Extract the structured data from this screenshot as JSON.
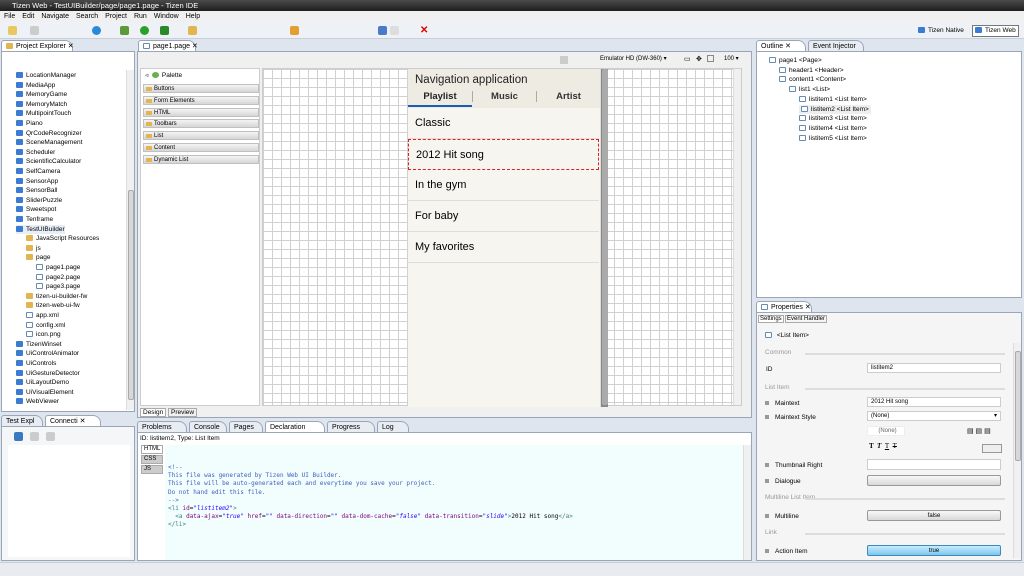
{
  "window": {
    "title": "Tizen Web - TestUIBuilder/page/page1.page - Tizen IDE"
  },
  "menu": [
    "File",
    "Edit",
    "Navigate",
    "Search",
    "Project",
    "Run",
    "Window",
    "Help"
  ],
  "perspectives": {
    "native": "Tizen Native",
    "web": "Tizen Web"
  },
  "project_explorer": {
    "title": "Project Explorer",
    "items": [
      {
        "label": "LocationManager",
        "type": "project",
        "level": 0
      },
      {
        "label": "MediaApp",
        "type": "project",
        "level": 0
      },
      {
        "label": "MemoryGame",
        "type": "project",
        "level": 0
      },
      {
        "label": "MemoryMatch",
        "type": "project",
        "level": 0
      },
      {
        "label": "MultipointTouch",
        "type": "project",
        "level": 0
      },
      {
        "label": "Piano",
        "type": "project",
        "level": 0
      },
      {
        "label": "QrCodeRecognizer",
        "type": "project",
        "level": 0
      },
      {
        "label": "SceneManagement",
        "type": "project",
        "level": 0
      },
      {
        "label": "Scheduler",
        "type": "project",
        "level": 0
      },
      {
        "label": "ScientificCalculator",
        "type": "project",
        "level": 0
      },
      {
        "label": "SelfCamera",
        "type": "project",
        "level": 0
      },
      {
        "label": "SensorApp",
        "type": "project",
        "level": 0
      },
      {
        "label": "SensorBall",
        "type": "project",
        "level": 0
      },
      {
        "label": "SliderPuzzle",
        "type": "project",
        "level": 0
      },
      {
        "label": "Sweetspot",
        "type": "project",
        "level": 0
      },
      {
        "label": "Tenframe",
        "type": "project",
        "level": 0
      },
      {
        "label": "TestUIBuilder",
        "type": "project-open",
        "level": 0
      },
      {
        "label": "JavaScript Resources",
        "type": "js",
        "level": 1
      },
      {
        "label": "js",
        "type": "folder",
        "level": 1
      },
      {
        "label": "page",
        "type": "folder",
        "level": 1
      },
      {
        "label": "page1.page",
        "type": "file",
        "level": 2
      },
      {
        "label": "page2.page",
        "type": "file",
        "level": 2
      },
      {
        "label": "page3.page",
        "type": "file",
        "level": 2
      },
      {
        "label": "tizen-ui-builder-fw",
        "type": "folder",
        "level": 1
      },
      {
        "label": "tizen-web-ui-fw",
        "type": "folder",
        "level": 1
      },
      {
        "label": "app.xml",
        "type": "file",
        "level": 1
      },
      {
        "label": "config.xml",
        "type": "file",
        "level": 1
      },
      {
        "label": "icon.png",
        "type": "file",
        "level": 1
      },
      {
        "label": "TizenWinset",
        "type": "project",
        "level": 0
      },
      {
        "label": "UiControlAnimator",
        "type": "project",
        "level": 0
      },
      {
        "label": "UiControls",
        "type": "project",
        "level": 0
      },
      {
        "label": "UiGestureDetector",
        "type": "project",
        "level": 0
      },
      {
        "label": "UiLayoutDemo",
        "type": "project",
        "level": 0
      },
      {
        "label": "UiVisualElement",
        "type": "project",
        "level": 0
      },
      {
        "label": "WebViewer",
        "type": "project",
        "level": 0
      }
    ]
  },
  "connections": {
    "tabs": [
      "Test Expl",
      "Connecti"
    ]
  },
  "editor": {
    "tab": "page1.page",
    "device": "Emulator HD (DW-360)",
    "zoom": "100",
    "palette": {
      "title": "Palette",
      "groups": [
        "Buttons",
        "Form Elements",
        "HTML",
        "Toolbars",
        "List",
        "Content",
        "Dynamic List"
      ]
    },
    "preview": {
      "header": "Navigation application",
      "tabs": [
        "Playlist",
        "Music",
        "Artist"
      ],
      "active_tab": "Playlist",
      "items": [
        "Classic",
        "2012 Hit song",
        "In the gym",
        "For baby",
        "My favorites"
      ],
      "selected": "2012 Hit song"
    },
    "bottom_tabs": [
      "Design",
      "Preview"
    ]
  },
  "bottom_panel": {
    "tabs": [
      "Problems",
      "Console",
      "Pages",
      "Declaration",
      "Progress",
      "Log"
    ],
    "active": "Declaration",
    "info": "ID: listitem2, Type: List Item",
    "langs": [
      "HTML",
      "CSS",
      "JS"
    ]
  },
  "outline": {
    "tabs": [
      "Outline",
      "Event Injector"
    ],
    "items": [
      {
        "label": "page1 <Page>",
        "level": 0
      },
      {
        "label": "header1 <Header>",
        "level": 1
      },
      {
        "label": "content1 <Content>",
        "level": 1
      },
      {
        "label": "list1 <List>",
        "level": 2
      },
      {
        "label": "listitem1 <List Item>",
        "level": 3
      },
      {
        "label": "listitem2 <List Item>",
        "level": 3,
        "selected": true
      },
      {
        "label": "listitem3 <List Item>",
        "level": 3
      },
      {
        "label": "listitem4 <List Item>",
        "level": 3
      },
      {
        "label": "listitem5 <List Item>",
        "level": 3
      }
    ]
  },
  "properties": {
    "title": "Properties",
    "tabs": [
      "Settings",
      "Event Handler"
    ],
    "element": "<List Item>",
    "sections": {
      "common": "Common",
      "list_item": "List Item",
      "multiline": "Multiline List Item",
      "link": "Link"
    },
    "id_label": "ID",
    "id_value": "listitem2",
    "maintext_label": "Maintext",
    "maintext_value": "2012 Hit song",
    "maintext_style_label": "Maintext Style",
    "maintext_style_value": "(None)",
    "font_value": "(None)",
    "thumbnail_label": "Thumbnail Right",
    "dialogue_label": "Dialogue",
    "multiline_label": "Multiline",
    "multiline_value": "false",
    "action_label": "Action Item",
    "action_value": "true"
  },
  "colors": {
    "accent": "#1a5fb4",
    "selection": "#e02020",
    "action_button": "#8fd0f5"
  }
}
